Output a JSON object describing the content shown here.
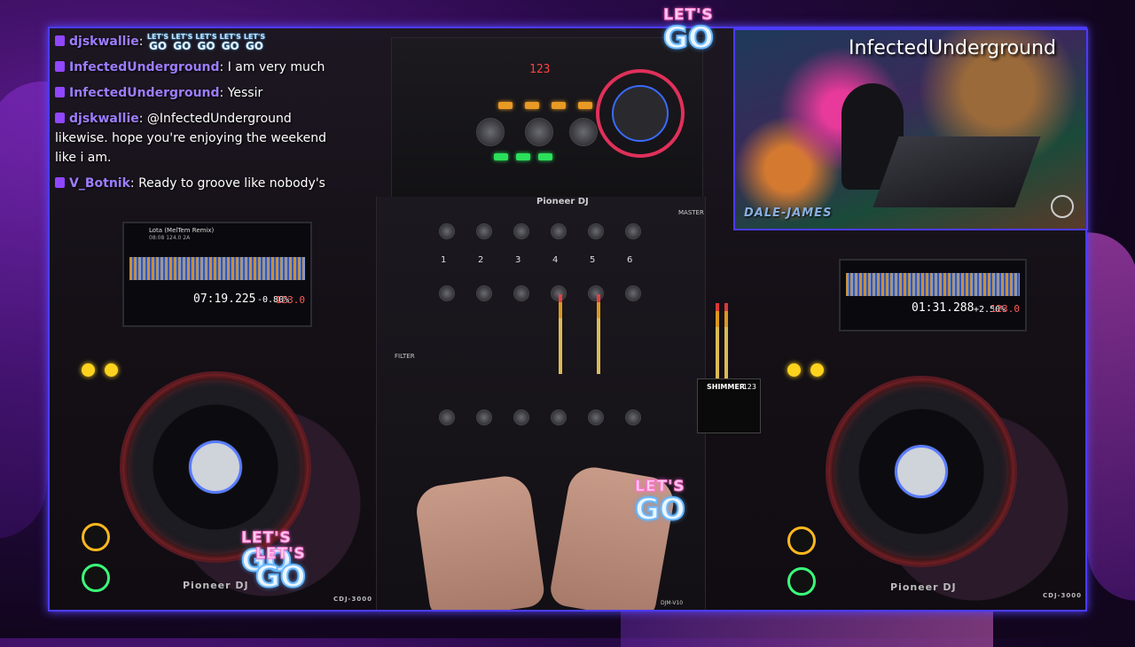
{
  "chat": {
    "messages": [
      {
        "user": "djskwallie",
        "text": "",
        "emotes": [
          "LET'S GO",
          "LET'S GO",
          "LET'S GO",
          "LET'S GO",
          "LET'S GO"
        ]
      },
      {
        "user": "InfectedUnderground",
        "text": "I am very much"
      },
      {
        "user": "InfectedUnderground",
        "text": "Yessir"
      },
      {
        "user": "djskwallie",
        "text": "@InfectedUnderground likewise. hope you're enjoying the weekend like i am."
      },
      {
        "user": "V_Botnik",
        "text": "Ready to groove like nobody's"
      }
    ],
    "emote": {
      "top": "LET'S",
      "bottom": "GO"
    }
  },
  "webcam": {
    "title": "InfectedUnderground",
    "signature": "DALE-JAMES"
  },
  "overlay": {
    "letsgo_top": "LET'S",
    "letsgo_bottom": "GO"
  },
  "decks": {
    "left": {
      "track": "Lota (MelTem Remix)",
      "meta": "08:08  124.0  2A",
      "time": "07:19.225",
      "pitch": "-0.80%",
      "bpm": "123.0",
      "brand": "Pioneer DJ",
      "model": "CDJ-3000"
    },
    "right": {
      "time": "01:31.288",
      "pitch": "+2.50%",
      "bpm": "123.0",
      "brand": "Pioneer DJ",
      "model": "CDJ-3000"
    }
  },
  "mixer": {
    "brand": "Pioneer DJ",
    "model": "DJM-V10",
    "master_label": "MASTER",
    "channels": [
      "1",
      "2",
      "3",
      "4",
      "5",
      "6"
    ],
    "fx_name": "SHIMMER",
    "fx_bpm": "123",
    "filter_label": "FILTER"
  },
  "effector": {
    "display": "123"
  },
  "colors": {
    "frame_border": "#4b3bff",
    "twitch_purple": "#9146ff",
    "username": "#9d7dff",
    "deck_red": "#e0303a",
    "button_yellow": "#ffd21e"
  }
}
